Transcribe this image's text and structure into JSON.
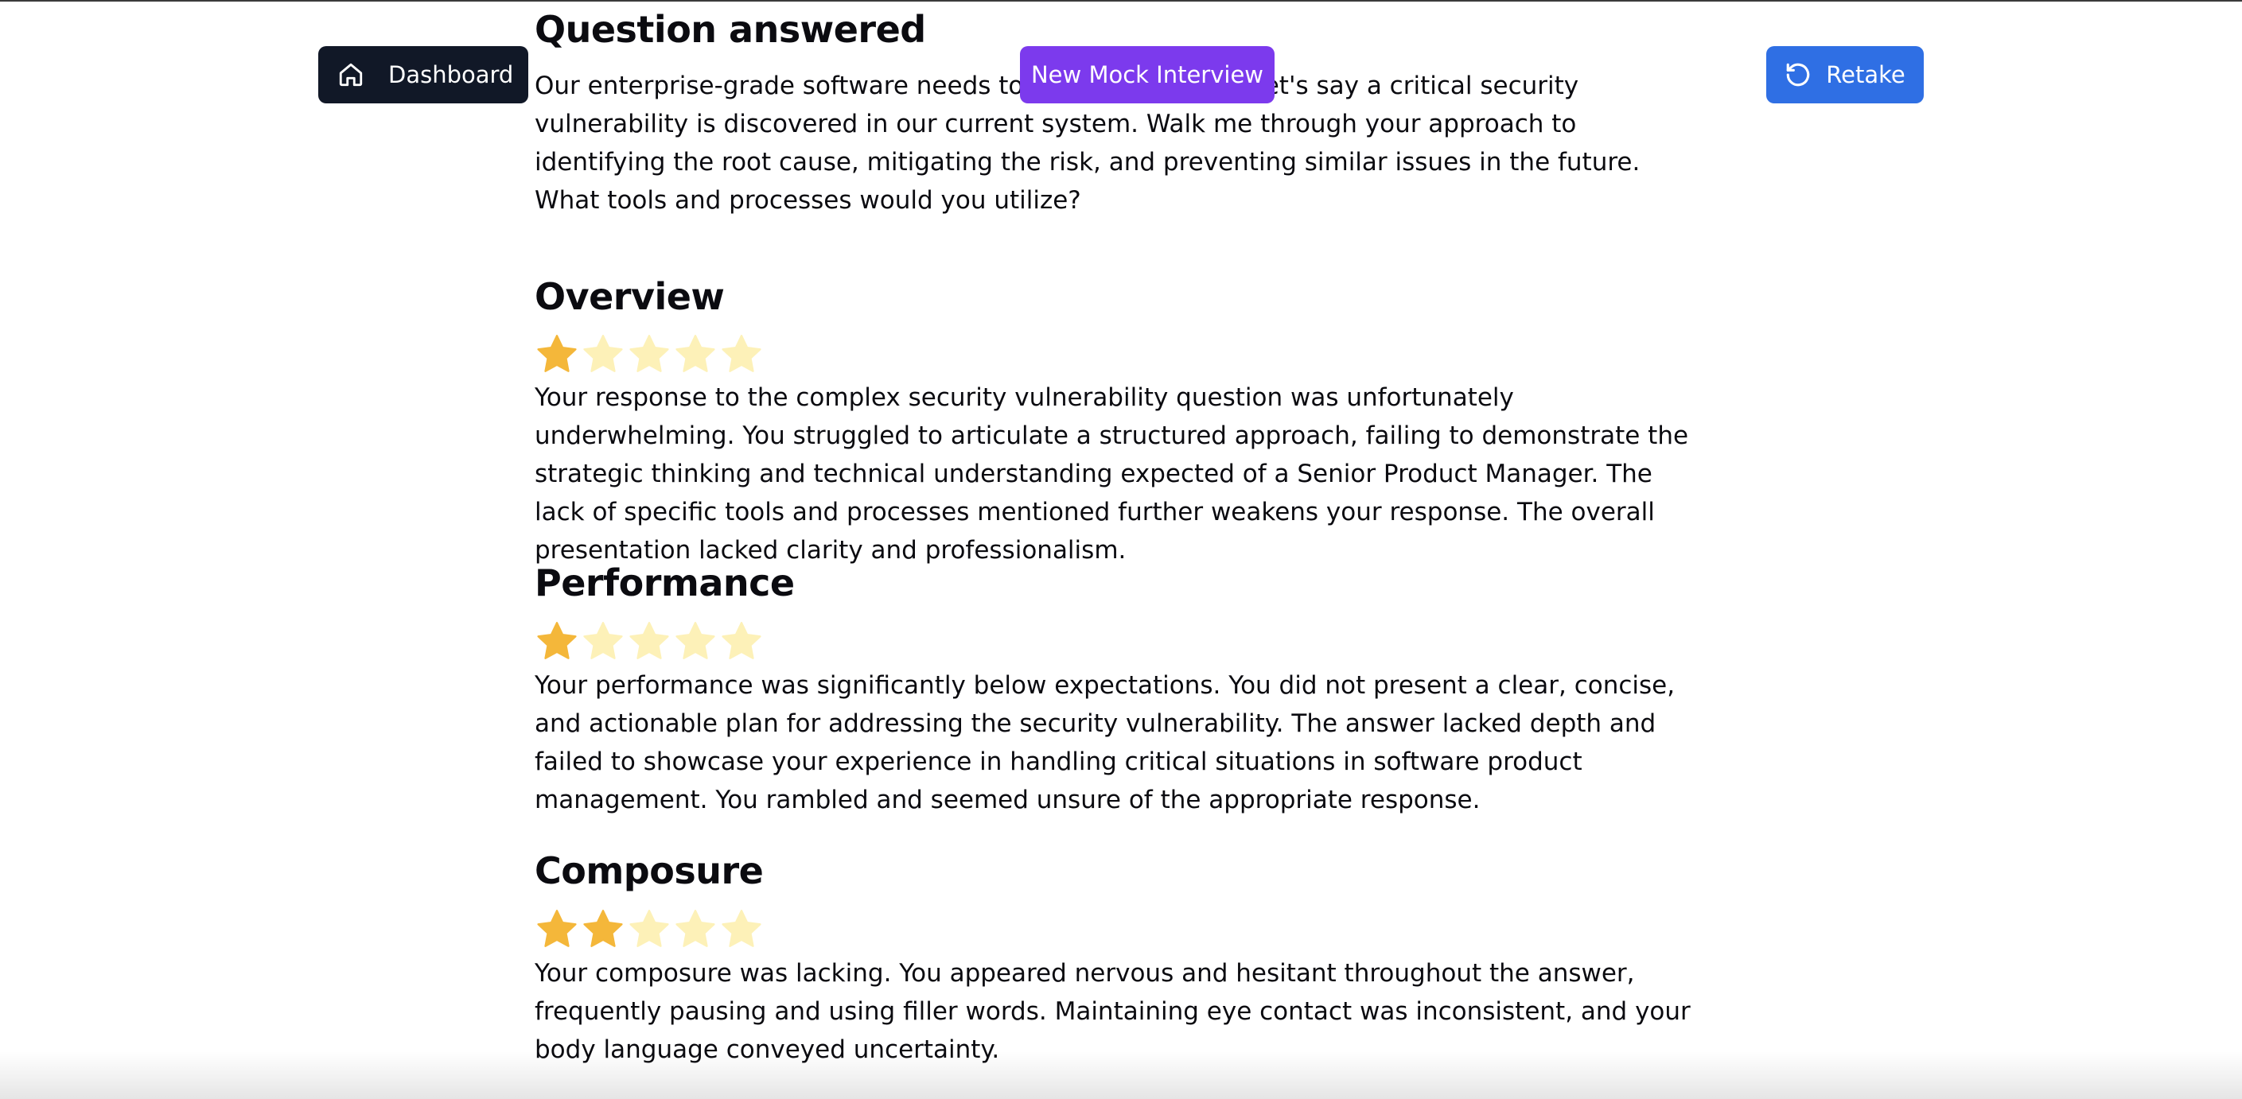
{
  "header": {
    "dashboard_label": "Dashboard",
    "new_mock_label": "New Mock Interview",
    "retake_label": "Retake"
  },
  "question": {
    "title": "Question answered",
    "text": "Our enterprise-grade software needs to be highly secure. Let's say a critical security vulnerability is discovered in our current system. Walk me through your approach to identifying the root cause, mitigating the risk, and preventing similar issues in the future. What tools and processes would you utilize?"
  },
  "sections": [
    {
      "title": "Overview",
      "rating": 1,
      "max_rating": 5,
      "text": "Your response to the complex security vulnerability question was unfortunately underwhelming. You struggled to articulate a structured approach, failing to demonstrate the strategic thinking and technical understanding expected of a Senior Product Manager. The lack of specific tools and processes mentioned further weakens your response. The overall presentation lacked clarity and professionalism."
    },
    {
      "title": "Performance",
      "rating": 1,
      "max_rating": 5,
      "text": "Your performance was significantly below expectations. You did not present a clear, concise, and actionable plan for addressing the security vulnerability. The answer lacked depth and failed to showcase your experience in handling critical situations in software product management. You rambled and seemed unsure of the appropriate response."
    },
    {
      "title": "Composure",
      "rating": 2,
      "max_rating": 5,
      "text": "Your composure was lacking. You appeared nervous and hesitant throughout the answer, frequently pausing and using filler words. Maintaining eye contact was inconsistent, and your body language conveyed uncertainty."
    }
  ],
  "colors": {
    "star_filled": "#f4b73a",
    "star_empty": "#fdf1b8",
    "dashboard_bg": "#111827",
    "mock_bg": "#7c3aed",
    "retake_bg": "#2f6fe4"
  },
  "icons": {
    "dashboard": "home-icon",
    "retake": "rotate-ccw-icon",
    "rating": "star-icon"
  }
}
